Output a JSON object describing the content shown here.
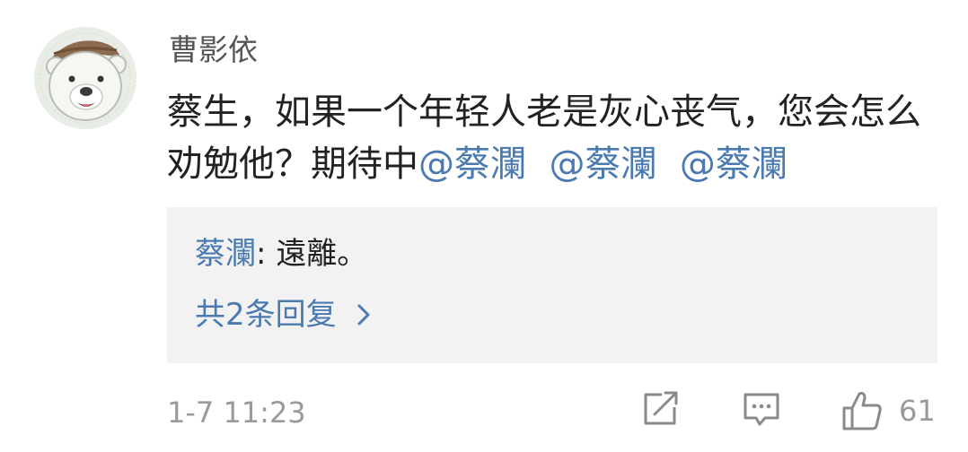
{
  "comment": {
    "username": "曹影依",
    "text_parts": [
      "蔡生，如果一个年轻人老是灰心丧气，您会怎么劝勉他？期待中"
    ],
    "mentions": [
      "@蔡瀾",
      "@蔡瀾",
      "@蔡瀾"
    ],
    "reply": {
      "author": "蔡瀾",
      "separator": ": ",
      "text": "遠離。"
    },
    "reply_count_label": "共2条回复",
    "timestamp": "1-7 11:23",
    "like_count": "61"
  },
  "icons": {
    "avatar": "polar-bear-avatar",
    "share": "share-icon",
    "comment": "comment-icon",
    "like": "thumbs-up-icon",
    "chevron": "chevron-right-icon"
  },
  "colors": {
    "link": "#4a7ab0",
    "muted": "#9a9a9a",
    "reply_bg": "#f2f2f2"
  }
}
